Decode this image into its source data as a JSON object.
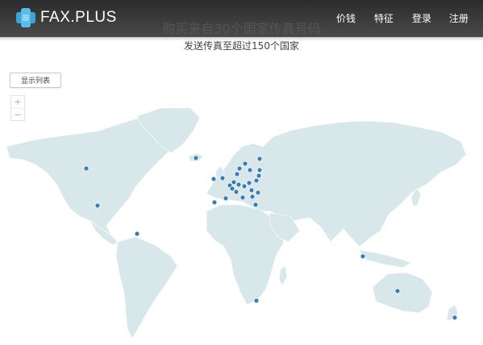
{
  "header": {
    "logo_text": "FAX.PLUS",
    "nav": [
      "价钱",
      "特征",
      "登录",
      "注册"
    ]
  },
  "hero": {
    "title": "购买来自30个国家传真号码",
    "subtitle": "发送传真至超过150个国家"
  },
  "map": {
    "show_list_label": "显示列表",
    "zoom_in": "+",
    "zoom_out": "−"
  },
  "colors": {
    "navbar": "#3a3a3a",
    "land": "#d7e7ea",
    "marker": "#3b7cb2",
    "logo_accent": "#3aa6d8"
  }
}
